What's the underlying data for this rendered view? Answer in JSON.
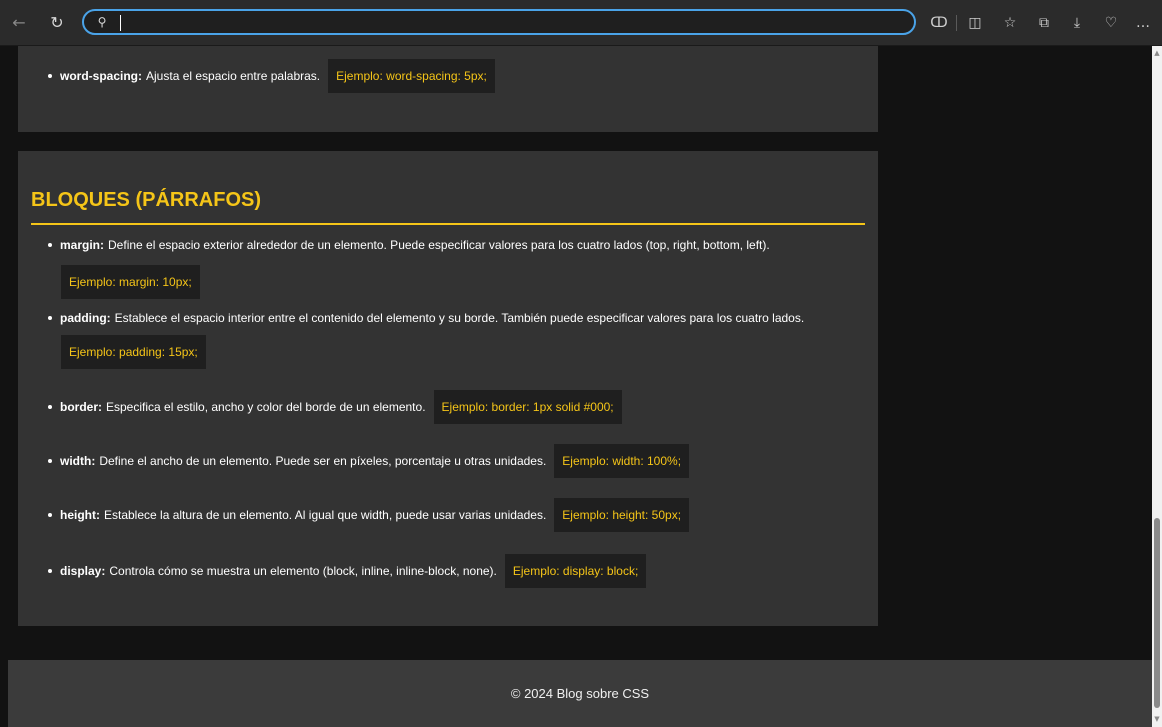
{
  "browser": {
    "address_value": "",
    "icons": [
      "back-arrow-icon",
      "reload-icon",
      "search-icon",
      "app-available-icon",
      "split-screen-icon",
      "favorites-icon",
      "collections-icon",
      "downloads-icon",
      "browser-essentials-icon",
      "more-options-icon"
    ]
  },
  "content": {
    "top_item": {
      "term": "word-spacing:",
      "desc": "Ajusta el espacio entre palabras.",
      "example": "Ejemplo: word-spacing: 5px;"
    },
    "section_title": "BLOQUES (PÁRRAFOS)",
    "items": [
      {
        "term": "margin:",
        "desc": "Define el espacio exterior alrededor de un elemento. Puede especificar valores para los cuatro lados (top, right, bottom, left).",
        "example": "Ejemplo: margin: 10px;"
      },
      {
        "term": "padding:",
        "desc": "Establece el espacio interior entre el contenido del elemento y su borde. También puede especificar valores para los cuatro lados.",
        "example": "Ejemplo: padding: 15px;"
      },
      {
        "term": "border:",
        "desc": "Especifica el estilo, ancho y color del borde de un elemento.",
        "example": "Ejemplo: border: 1px solid #000;"
      },
      {
        "term": "width:",
        "desc": "Define el ancho de un elemento. Puede ser en píxeles, porcentaje u otras unidades.",
        "example": "Ejemplo: width: 100%;"
      },
      {
        "term": "height:",
        "desc": "Establece la altura de un elemento. Al igual que width, puede usar varias unidades.",
        "example": "Ejemplo: height: 50px;"
      },
      {
        "term": "display:",
        "desc": "Controla cómo se muestra un elemento (block, inline, inline-block, none).",
        "example": "Ejemplo: display: block;"
      }
    ]
  },
  "footer": {
    "text": "© 2024 Blog sobre CSS"
  },
  "colors": {
    "accent": "#f5c518",
    "card_bg": "#333333",
    "page_bg": "#121212",
    "code_bg": "#1f1f1f",
    "address_border": "#4aa3e8"
  }
}
